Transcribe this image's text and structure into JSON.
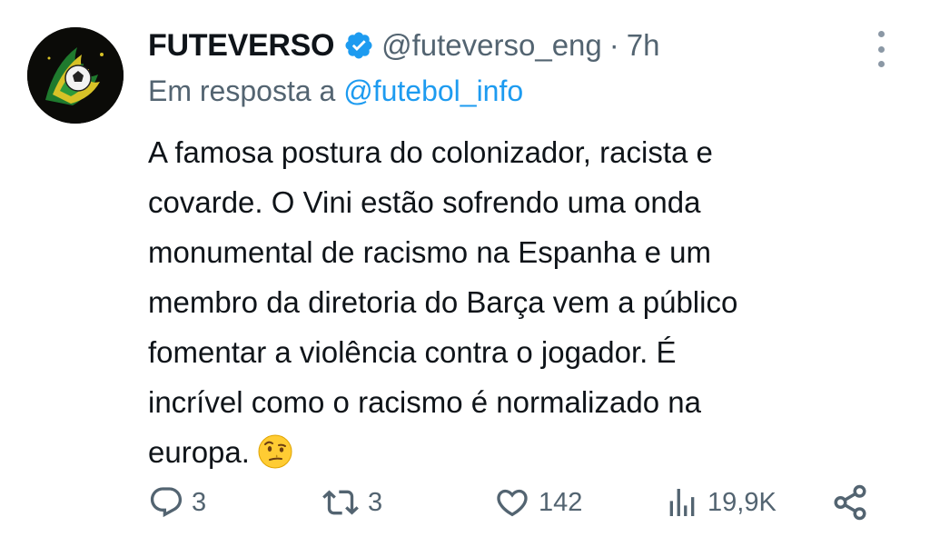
{
  "author": {
    "name": "FUTEVERSO",
    "handle": "@futeverso_eng",
    "separator": "·",
    "time": "7h"
  },
  "reply": {
    "prefix": "Em resposta a",
    "mention": "@futebol_info"
  },
  "tweet": {
    "lines": [
      "A famosa postura do colonizador, racista e",
      "covarde. O Vini estão sofrendo uma onda",
      "monumental de racismo na Espanha e um",
      "membro da diretoria do Barça vem a público",
      "fomentar a violência contra o jogador. É",
      "incrível como o racismo é normalizado na",
      "europa."
    ],
    "emoji_icon": "face-with-raised-eyebrow-emoji"
  },
  "actions": {
    "replies": "3",
    "retweets": "3",
    "likes": "142",
    "views": "19,9K"
  },
  "colors": {
    "text": "#0f1419",
    "secondary": "#536471",
    "link": "#1d9bf0",
    "verified": "#1d9bf0"
  }
}
